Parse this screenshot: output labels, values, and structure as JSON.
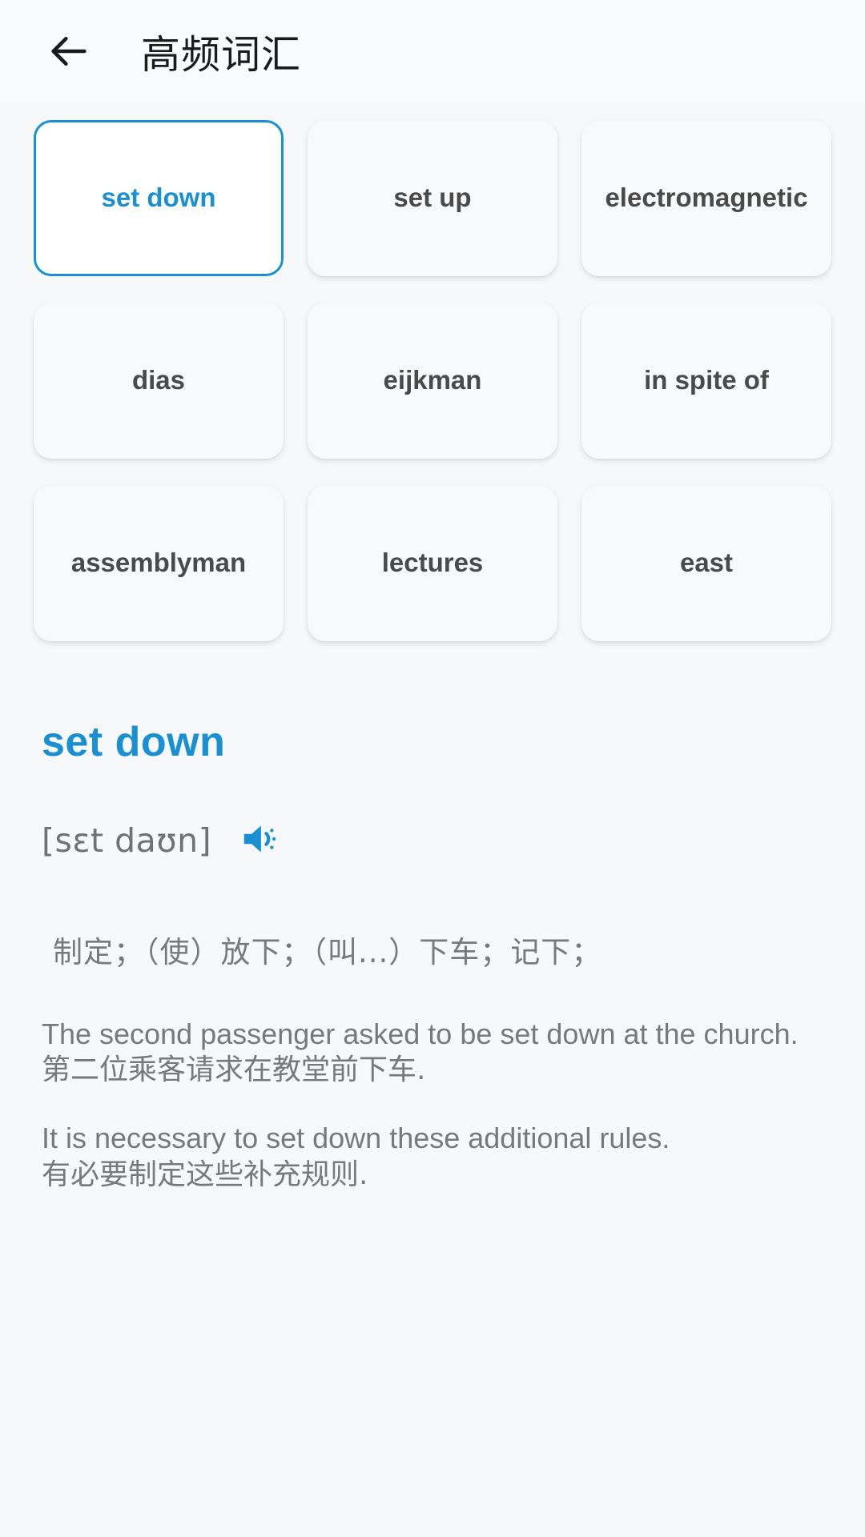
{
  "header": {
    "back_icon": "arrow-left-icon",
    "title": "高频词汇"
  },
  "accent_color": "#1a8fd1",
  "text_color": "#4a4a4a",
  "muted_color": "#77797b",
  "background_color": "#f7f8f9",
  "grid": {
    "selected_index": 0,
    "cards": [
      {
        "label": "set down",
        "selected": true
      },
      {
        "label": "set up",
        "selected": false
      },
      {
        "label": "electromagnetic",
        "selected": false
      },
      {
        "label": "dias",
        "selected": false
      },
      {
        "label": "eijkman",
        "selected": false
      },
      {
        "label": "in spite of",
        "selected": false
      },
      {
        "label": "assemblyman",
        "selected": false
      },
      {
        "label": "lectures",
        "selected": false
      },
      {
        "label": "east",
        "selected": false
      }
    ]
  },
  "detail": {
    "word": "set down",
    "phonetic": "[sɛt daʊn]",
    "speaker_icon": "speaker-icon",
    "definition": "制定；（使）放下；（叫...）下车；记下；",
    "examples": [
      {
        "en": "The second passenger asked to be set down at the church.",
        "zh": "第二位乘客请求在教堂前下车."
      },
      {
        "en": "It is necessary to set down these additional rules.",
        "zh": "有必要制定这些补充规则."
      }
    ]
  }
}
